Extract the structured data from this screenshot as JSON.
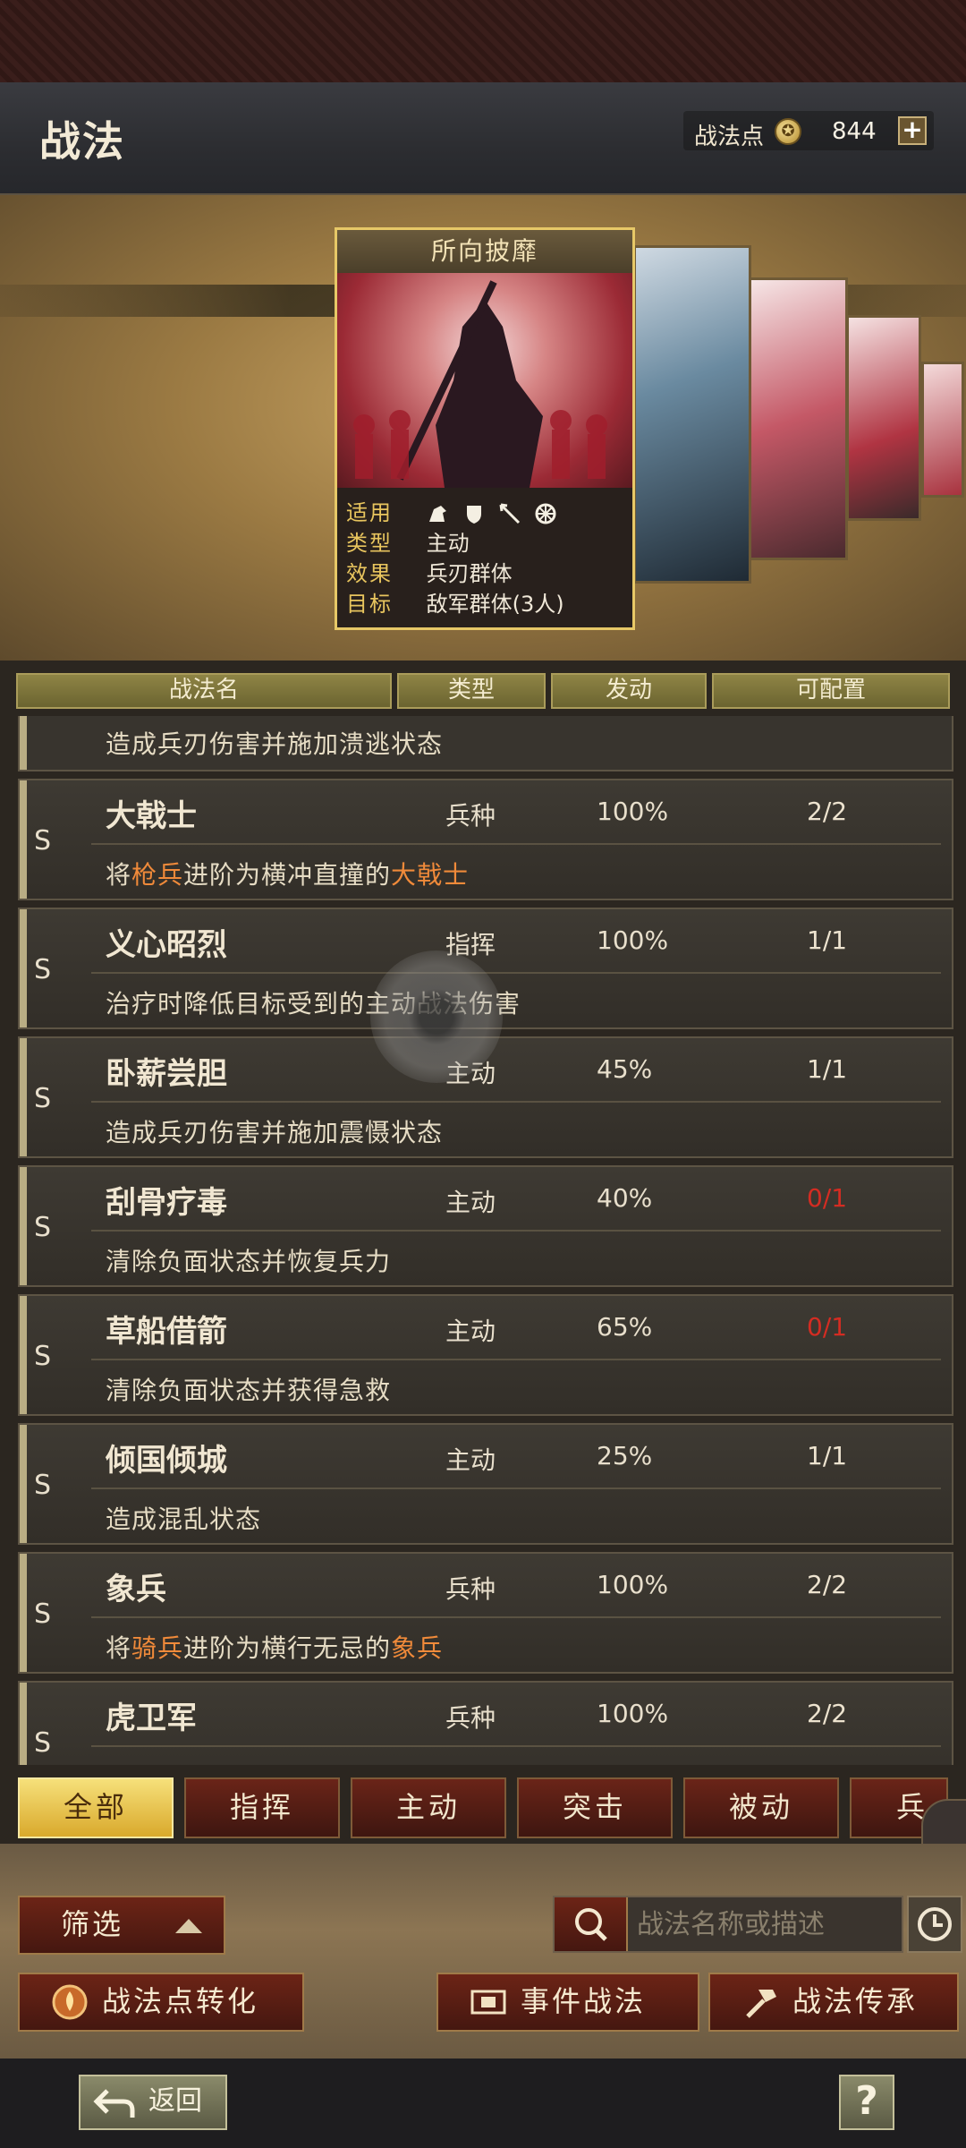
{
  "header": {
    "title": "战法",
    "points_label": "战法点",
    "points_value": "844",
    "plus": "+"
  },
  "card": {
    "title": "所向披靡",
    "applicable_label": "适用",
    "applicable_icons": [
      "cavalry-icon",
      "shield-icon",
      "archer-icon",
      "wheel-icon"
    ],
    "type_label": "类型",
    "type_value": "主动",
    "effect_label": "效果",
    "effect_value": "兵刃群体",
    "target_label": "目标",
    "target_value": "敌军群体(3人)"
  },
  "table": {
    "headers": [
      "战法名",
      "类型",
      "发动",
      "可配置"
    ],
    "partial_top_desc": "造成兵刃伤害并施加溃逃状态",
    "rows": [
      {
        "grade": "S",
        "name": "大戟士",
        "type": "兵种",
        "rate": "100%",
        "quota": "2/2",
        "quota_red": false,
        "desc": [
          "将",
          "枪兵",
          "进阶为横冲直撞的",
          "大戟士"
        ]
      },
      {
        "grade": "S",
        "name": "义心昭烈",
        "type": "指挥",
        "rate": "100%",
        "quota": "1/1",
        "quota_red": false,
        "desc": [
          "治疗时降低目标受到的主动战法伤害"
        ]
      },
      {
        "grade": "S",
        "name": "卧薪尝胆",
        "type": "主动",
        "rate": "45%",
        "quota": "1/1",
        "quota_red": false,
        "desc": [
          "造成兵刃伤害并施加震慑状态"
        ]
      },
      {
        "grade": "S",
        "name": "刮骨疗毒",
        "type": "主动",
        "rate": "40%",
        "quota": "0/1",
        "quota_red": true,
        "desc": [
          "清除负面状态并恢复兵力"
        ]
      },
      {
        "grade": "S",
        "name": "草船借箭",
        "type": "主动",
        "rate": "65%",
        "quota": "0/1",
        "quota_red": true,
        "desc": [
          "清除负面状态并获得急救"
        ]
      },
      {
        "grade": "S",
        "name": "倾国倾城",
        "type": "主动",
        "rate": "25%",
        "quota": "1/1",
        "quota_red": false,
        "desc": [
          "造成混乱状态"
        ]
      },
      {
        "grade": "S",
        "name": "象兵",
        "type": "兵种",
        "rate": "100%",
        "quota": "2/2",
        "quota_red": false,
        "desc": [
          "将",
          "骑兵",
          "进阶为横行无忌的",
          "象兵"
        ]
      },
      {
        "grade": "S",
        "name": "虎卫军",
        "type": "兵种",
        "rate": "100%",
        "quota": "2/2",
        "quota_red": false,
        "desc": []
      }
    ]
  },
  "tabs": [
    "全部",
    "指挥",
    "主动",
    "突击",
    "被动",
    "兵"
  ],
  "controls": {
    "filter_label": "筛选",
    "search_placeholder": "战法名称或描述",
    "convert_label": "战法点转化",
    "event_label": "事件战法",
    "inherit_label": "战法传承"
  },
  "footer": {
    "back_label": "返回",
    "help_label": "?"
  },
  "colors": {
    "accent_gold": "#e7c867",
    "highlight_orange": "#f08a3a",
    "quota_red": "#d42c22"
  }
}
